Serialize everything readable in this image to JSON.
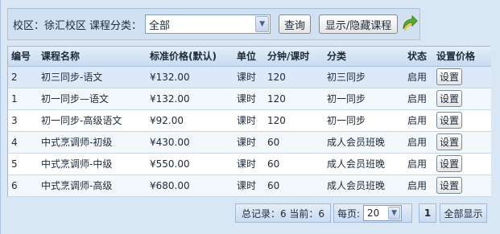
{
  "toolbar": {
    "campus_label": "校区：",
    "campus_value": "徐汇校区",
    "category_label": "课程分类：",
    "category_value": "全部",
    "query_label": "查询",
    "toggle_label": "显示/隐藏课程",
    "refresh_icon": "refresh-arrow-icon"
  },
  "table": {
    "headers": [
      "编号",
      "课程名称",
      "标准价格(默认)",
      "单位",
      "分钟/课时",
      "分类",
      "状态",
      "设置价格"
    ],
    "rows": [
      {
        "id": "2",
        "name": "初三同步-语文",
        "price": "¥132.00",
        "unit": "课时",
        "minutes": "120",
        "category": "初三同步",
        "status": "启用",
        "action": "设置"
      },
      {
        "id": "1",
        "name": "初一同步—语文",
        "price": "¥132.00",
        "unit": "课时",
        "minutes": "120",
        "category": "初一同步",
        "status": "启用",
        "action": "设置"
      },
      {
        "id": "3",
        "name": "初一同步-高级语文",
        "price": "¥92.00",
        "unit": "课时",
        "minutes": "120",
        "category": "初一同步",
        "status": "启用",
        "action": "设置"
      },
      {
        "id": "4",
        "name": "中式烹调师-初级",
        "price": "¥430.00",
        "unit": "课时",
        "minutes": "60",
        "category": "成人会员班晚",
        "status": "启用",
        "action": "设置"
      },
      {
        "id": "5",
        "name": "中式烹调师-中级",
        "price": "¥550.00",
        "unit": "课时",
        "minutes": "60",
        "category": "成人会员班晚",
        "status": "启用",
        "action": "设置"
      },
      {
        "id": "6",
        "name": "中式烹调师-高级",
        "price": "¥680.00",
        "unit": "课时",
        "minutes": "60",
        "category": "成人会员班晚",
        "status": "启用",
        "action": "设置"
      }
    ]
  },
  "pager": {
    "total_text": "总记录：6 当前：6",
    "per_page_label": "每页:",
    "per_page_value": "20",
    "current_page": "1",
    "show_all_label": "全部显示"
  },
  "colors": {
    "background": "#d9e6f4",
    "header_gradient_top": "#e4eef9",
    "selected_row": "#dde9f8",
    "border": "#9fb9d6"
  }
}
